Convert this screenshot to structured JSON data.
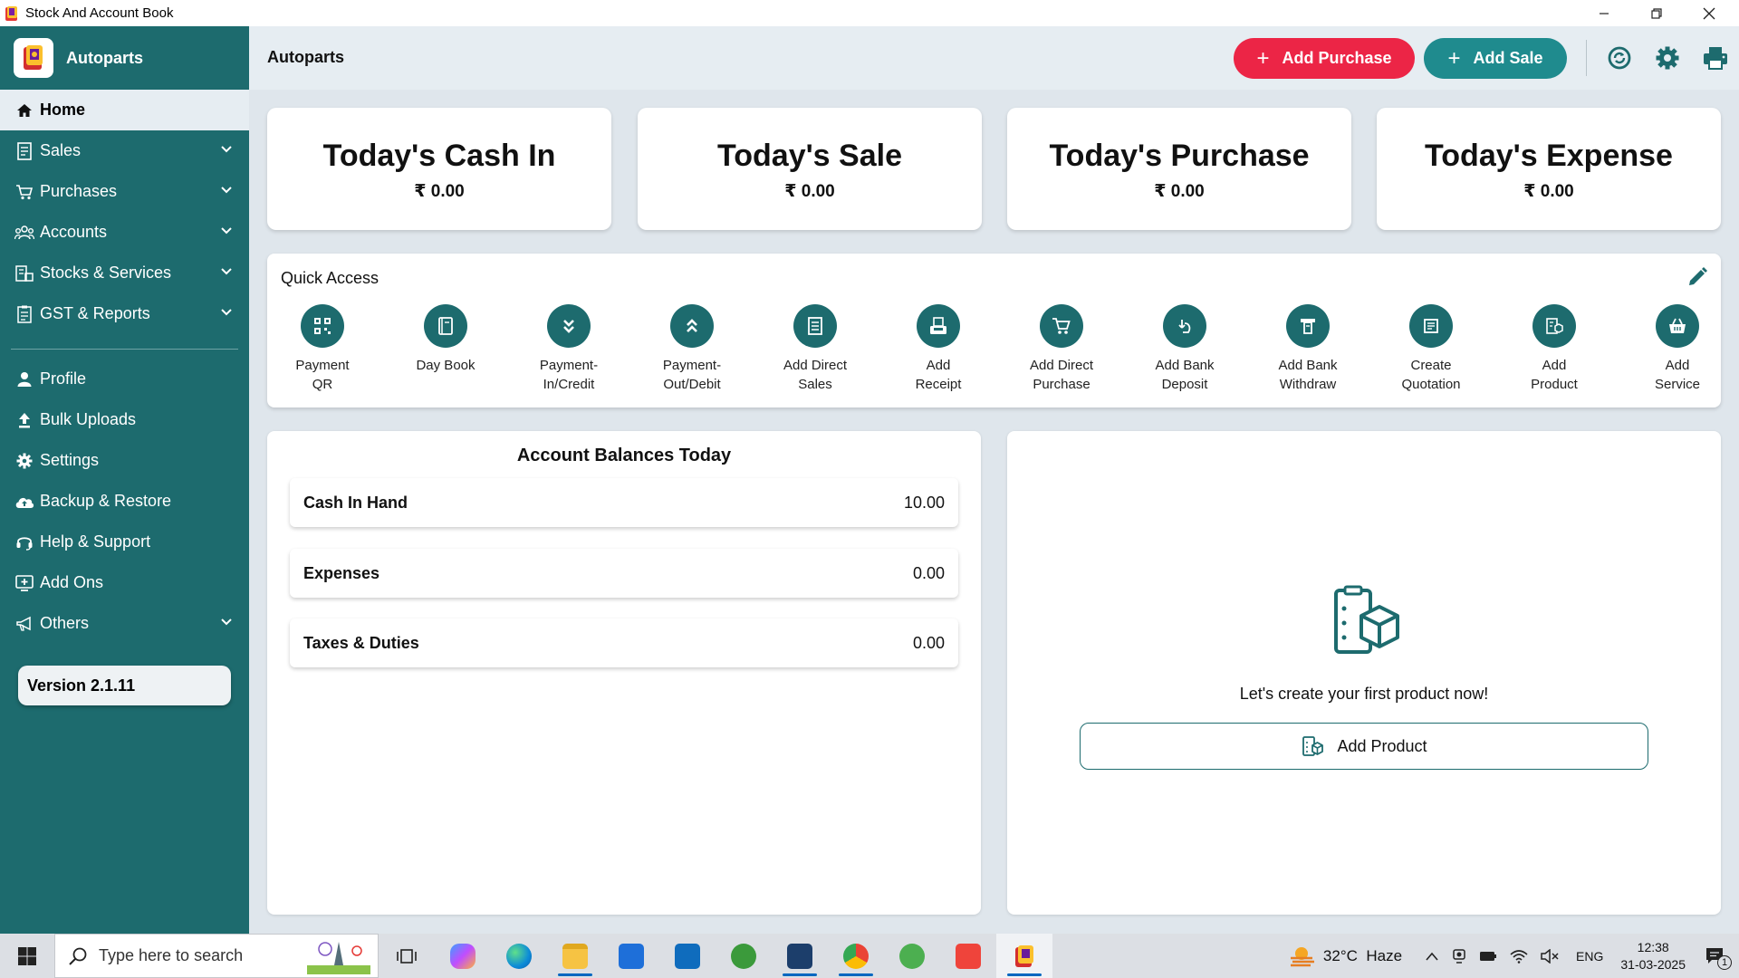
{
  "window": {
    "title": "Stock And Account Book"
  },
  "sidebar": {
    "brand": "Autoparts",
    "items": [
      {
        "label": "Home",
        "icon": "home-icon",
        "active": true,
        "expandable": false
      },
      {
        "label": "Sales",
        "icon": "receipt-icon",
        "expandable": true
      },
      {
        "label": "Purchases",
        "icon": "cart-icon",
        "expandable": true
      },
      {
        "label": "Accounts",
        "icon": "people-icon",
        "expandable": true
      },
      {
        "label": "Stocks & Services",
        "icon": "stock-icon",
        "expandable": true
      },
      {
        "label": "GST & Reports",
        "icon": "report-icon",
        "expandable": true
      }
    ],
    "items2": [
      {
        "label": "Profile",
        "icon": "person-icon"
      },
      {
        "label": "Bulk Uploads",
        "icon": "upload-icon"
      },
      {
        "label": "Settings",
        "icon": "gear-icon"
      },
      {
        "label": "Backup & Restore",
        "icon": "cloud-icon"
      },
      {
        "label": "Help & Support",
        "icon": "headset-icon"
      },
      {
        "label": "Add Ons",
        "icon": "addons-icon"
      },
      {
        "label": "Others",
        "icon": "megaphone-icon",
        "expandable": true
      }
    ],
    "version": "Version 2.1.11"
  },
  "header": {
    "title": "Autoparts",
    "add_purchase": "Add Purchase",
    "add_sale": "Add Sale",
    "icons": [
      "sync-icon",
      "gear-icon",
      "printer-icon"
    ]
  },
  "stats": [
    {
      "label": "Today's Cash In",
      "value": "₹ 0.00"
    },
    {
      "label": "Today's Sale",
      "value": "₹ 0.00"
    },
    {
      "label": "Today's Purchase",
      "value": "₹ 0.00"
    },
    {
      "label": "Today's Expense",
      "value": "₹ 0.00"
    }
  ],
  "quick_access": {
    "title": "Quick Access",
    "items": [
      {
        "line1": "Payment",
        "line2": "QR",
        "icon": "qr-icon"
      },
      {
        "line1": "Day Book",
        "line2": "",
        "icon": "book-icon"
      },
      {
        "line1": "Payment-",
        "line2": "In/Credit",
        "icon": "chevrons-down-icon"
      },
      {
        "line1": "Payment-",
        "line2": "Out/Debit",
        "icon": "chevrons-up-icon"
      },
      {
        "line1": "Add Direct",
        "line2": "Sales",
        "icon": "invoice-icon"
      },
      {
        "line1": "Add",
        "line2": "Receipt",
        "icon": "receipt-printer-icon"
      },
      {
        "line1": "Add Direct",
        "line2": "Purchase",
        "icon": "cart-icon"
      },
      {
        "line1": "Add Bank",
        "line2": "Deposit",
        "icon": "deposit-icon"
      },
      {
        "line1": "Add Bank",
        "line2": "Withdraw",
        "icon": "withdraw-icon"
      },
      {
        "line1": "Create",
        "line2": "Quotation",
        "icon": "quotation-icon"
      },
      {
        "line1": "Add",
        "line2": "Product",
        "icon": "product-icon"
      },
      {
        "line1": "Add",
        "line2": "Service",
        "icon": "service-basket-icon"
      }
    ]
  },
  "balances": {
    "title": "Account Balances Today",
    "rows": [
      {
        "label": "Cash In Hand",
        "value": "10.00"
      },
      {
        "label": "Expenses",
        "value": "0.00"
      },
      {
        "label": "Taxes & Duties",
        "value": "0.00"
      }
    ]
  },
  "product_panel": {
    "message": "Let's create your first product now!",
    "button": "Add Product"
  },
  "taskbar": {
    "search_placeholder": "Type here to search",
    "weather": "32°C  Haze",
    "lang": "ENG",
    "time": "12:38",
    "date": "31-03-2025",
    "notifications": "1"
  },
  "colors": {
    "primary": "#1d6b6e",
    "purchase": "#ec2546",
    "sale": "#1f8b8e",
    "background": "#dfe6ec"
  }
}
